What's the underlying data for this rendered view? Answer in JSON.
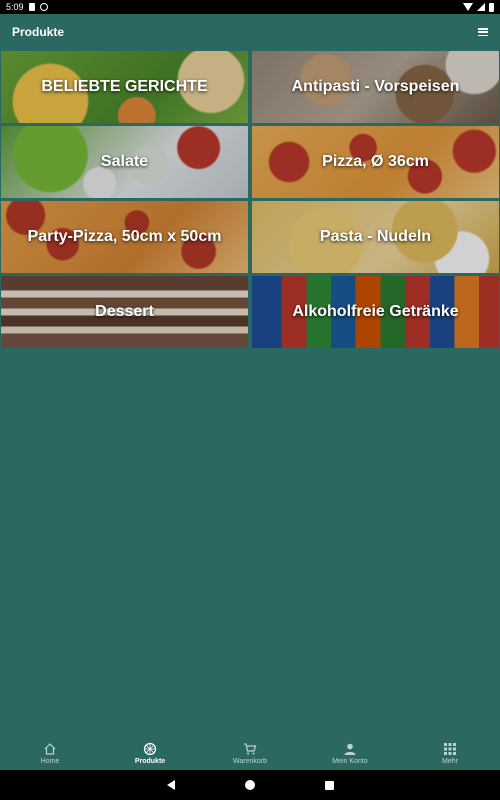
{
  "status_bar": {
    "time": "5:09"
  },
  "app_bar": {
    "title": "Produkte",
    "menu_icon": "menu-icon"
  },
  "categories": [
    {
      "label": "BELIEBTE GERICHTE"
    },
    {
      "label": "Antipasti - Vorspeisen"
    },
    {
      "label": "Salate"
    },
    {
      "label": "Pizza, Ø 36cm"
    },
    {
      "label": "Party-Pizza, 50cm x 50cm"
    },
    {
      "label": "Pasta - Nudeln"
    },
    {
      "label": "Dessert"
    },
    {
      "label": "Alkoholfreie Getränke"
    }
  ],
  "bottom_nav": {
    "items": [
      {
        "label": "Home",
        "icon": "home-icon"
      },
      {
        "label": "Produkte",
        "icon": "pizza-icon",
        "active": true
      },
      {
        "label": "Warenkorb",
        "icon": "cart-icon"
      },
      {
        "label": "Mein Konto",
        "icon": "account-icon"
      },
      {
        "label": "Mehr",
        "icon": "grid-icon"
      }
    ]
  },
  "colors": {
    "primary": "#2a6861",
    "text": "#ffffff"
  }
}
